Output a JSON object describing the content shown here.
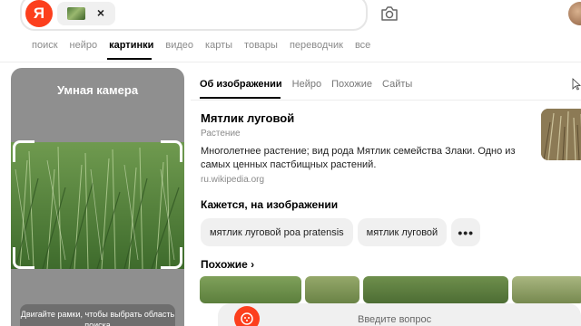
{
  "search": {
    "logo_letter": "Я",
    "clear_symbol": "×"
  },
  "nav_tabs": [
    {
      "label": "поиск"
    },
    {
      "label": "нейро"
    },
    {
      "label": "картинки",
      "active": true
    },
    {
      "label": "видео"
    },
    {
      "label": "карты"
    },
    {
      "label": "товары"
    },
    {
      "label": "переводчик"
    },
    {
      "label": "все"
    }
  ],
  "camera": {
    "title": "Умная камера",
    "hint": "Двигайте рамки, чтобы выбрать область поиска"
  },
  "info_tabs": [
    {
      "label": "Об изображении",
      "active": true
    },
    {
      "label": "Нейро"
    },
    {
      "label": "Похожие"
    },
    {
      "label": "Сайты"
    }
  ],
  "result": {
    "title": "Мятлик луговой",
    "type": "Растение",
    "description": "Многолетнее растение; вид рода Мятлик семейства Злаки. Одно из самых ценных пастбищных растений.",
    "source": "ru.wikipedia.org"
  },
  "detected": {
    "heading": "Кажется, на изображении",
    "chips": [
      "мятлик луговой poa pratensis",
      "мятлик луговой"
    ],
    "more_symbol": "•••"
  },
  "similar": {
    "heading": "Похожие ›"
  },
  "ask": {
    "placeholder": "Введите вопрос"
  },
  "colors": {
    "brand": "#fc3f1d",
    "panel_gray": "#8f8f8f",
    "chip_bg": "#f0f0f0"
  }
}
